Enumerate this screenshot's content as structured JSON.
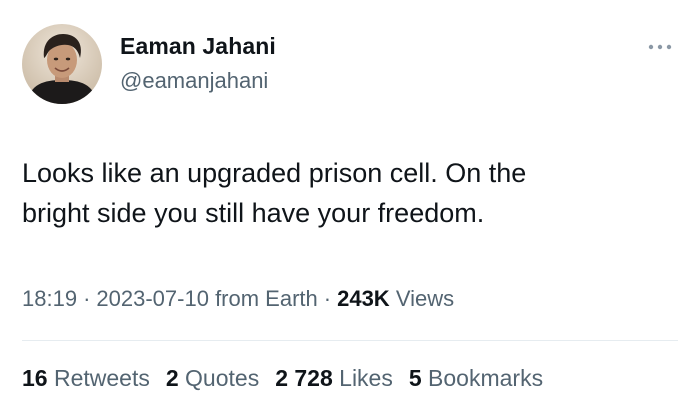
{
  "author": {
    "name": "Eaman Jahani",
    "handle": "@eamanjahani"
  },
  "tweet": {
    "lines": [
      "Looks like an upgraded prison cell. On the",
      "bright side you still have your freedom."
    ]
  },
  "meta": {
    "time": "18:19",
    "separator": "·",
    "date": "2023-07-10",
    "source": "from Earth",
    "views_count": "243K",
    "views_label": "Views"
  },
  "stats": {
    "retweets": {
      "count": "16",
      "label": "Retweets"
    },
    "quotes": {
      "count": "2",
      "label": "Quotes"
    },
    "likes": {
      "count": "2 728",
      "label": "Likes"
    },
    "bookmarks": {
      "count": "5",
      "label": "Bookmarks"
    }
  },
  "icons": {
    "more": "more-horizontal-icon"
  },
  "colors": {
    "text_primary": "#0f1419",
    "text_secondary": "#536471",
    "divider": "#e6ecf0"
  }
}
